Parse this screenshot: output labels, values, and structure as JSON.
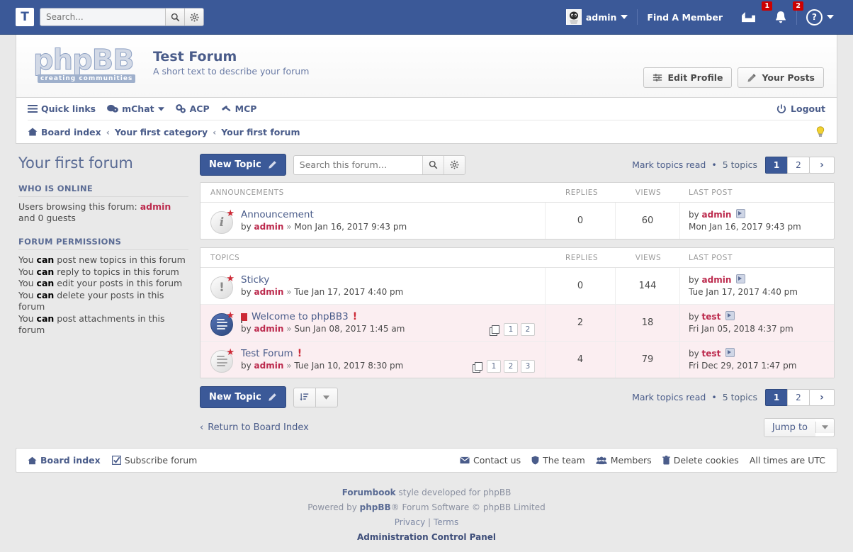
{
  "topbar": {
    "logo_letter": "T",
    "search_placeholder": "Search...",
    "search_value": "",
    "search_icon": "magnifier-icon",
    "settings_icon": "gear-icon",
    "username": "admin",
    "find_member": "Find A Member",
    "messages_count": "1",
    "notifications_count": "2",
    "help_glyph": "?"
  },
  "header": {
    "logo_text": "phpBB",
    "logo_sub": "creating communities",
    "title": "Test Forum",
    "description": "A short text to describe your forum",
    "edit_profile": "Edit Profile",
    "your_posts": "Your Posts"
  },
  "nav": {
    "quick_links": "Quick links",
    "mchat": "mChat",
    "acp": "ACP",
    "mcp": "MCP",
    "logout": "Logout",
    "breadcrumbs": [
      "Board index",
      "Your first category",
      "Your first forum"
    ],
    "crumb_separator": "‹"
  },
  "sidebar": {
    "page_title": "Your first forum",
    "who_online_title": "WHO IS ONLINE",
    "who_online_prefix": "Users browsing this forum:",
    "who_online_user": "admin",
    "who_online_suffix": "and 0 guests",
    "permissions_title": "FORUM PERMISSIONS",
    "permissions": [
      {
        "pre": "You ",
        "can": "can",
        "post": " post new topics in this forum"
      },
      {
        "pre": "You ",
        "can": "can",
        "post": " reply to topics in this forum"
      },
      {
        "pre": "You ",
        "can": "can",
        "post": " edit your posts in this forum"
      },
      {
        "pre": "You ",
        "can": "can",
        "post": " delete your posts in this forum"
      },
      {
        "pre": "You ",
        "can": "can",
        "post": " post attachments in this forum"
      }
    ]
  },
  "toolbar": {
    "new_topic": "New Topic",
    "search_placeholder": "Search this forum…",
    "search_value": "",
    "mark_read": "Mark topics read",
    "topic_count": "5 topics",
    "separator": "•",
    "pages": [
      "1",
      "2"
    ],
    "active_page": "1",
    "next_glyph": "›"
  },
  "announcements": {
    "heading": "ANNOUNCEMENTS",
    "col_replies": "REPLIES",
    "col_views": "VIEWS",
    "col_lastpost": "LAST POST",
    "rows": [
      {
        "icon": "announcement-icon",
        "title": "Announcement",
        "author_prefix": "by",
        "author": "admin",
        "sep": "»",
        "date": "Mon Jan 16, 2017 9:43 pm",
        "replies": "0",
        "views": "60",
        "last_by": "by",
        "last_author": "admin",
        "last_date": "Mon Jan 16, 2017 9:43 pm",
        "unread": false,
        "pages": []
      }
    ]
  },
  "topics": {
    "heading": "TOPICS",
    "col_replies": "REPLIES",
    "col_views": "VIEWS",
    "col_lastpost": "LAST POST",
    "rows": [
      {
        "icon": "sticky-icon",
        "title": "Sticky",
        "author_prefix": "by",
        "author": "admin",
        "sep": "»",
        "date": "Tue Jan 17, 2017 4:40 pm",
        "replies": "0",
        "views": "144",
        "last_by": "by",
        "last_author": "admin",
        "last_date": "Tue Jan 17, 2017 4:40 pm",
        "unread": false,
        "pages": []
      },
      {
        "icon": "unread-topic-icon",
        "title": "Welcome to phpBB3",
        "attention": "!",
        "author_prefix": "by",
        "author": "admin",
        "sep": "»",
        "date": "Sun Jan 08, 2017 1:45 am",
        "replies": "2",
        "views": "18",
        "last_by": "by",
        "last_author": "test",
        "last_date": "Fri Jan 05, 2018 4:37 pm",
        "unread": true,
        "has_flag": true,
        "pages": [
          "1",
          "2"
        ]
      },
      {
        "icon": "read-topic-icon",
        "title": "Test Forum",
        "attention": "!",
        "author_prefix": "by",
        "author": "admin",
        "sep": "»",
        "date": "Tue Jan 10, 2017 8:30 pm",
        "replies": "4",
        "views": "79",
        "last_by": "by",
        "last_author": "test",
        "last_date": "Fri Dec 29, 2017 1:47 pm",
        "unread": true,
        "has_flag": false,
        "pages": [
          "1",
          "2",
          "3"
        ]
      }
    ]
  },
  "bottom": {
    "return_link": "Return to Board Index",
    "return_arrow": "‹",
    "jump_to": "Jump to"
  },
  "footer": {
    "board_index": "Board index",
    "subscribe": "Subscribe forum",
    "contact": "Contact us",
    "team": "The team",
    "members": "Members",
    "delete_cookies": "Delete cookies",
    "timezone": "All times are UTC",
    "style_strong": "Forumbook",
    "style_rest": "style developed for phpBB",
    "powered_pre": "Powered by",
    "powered_strong": "phpBB",
    "powered_rest": "® Forum Software © phpBB Limited",
    "privacy": "Privacy",
    "pipe": "|",
    "terms": "Terms",
    "acp": "Administration Control Panel"
  }
}
